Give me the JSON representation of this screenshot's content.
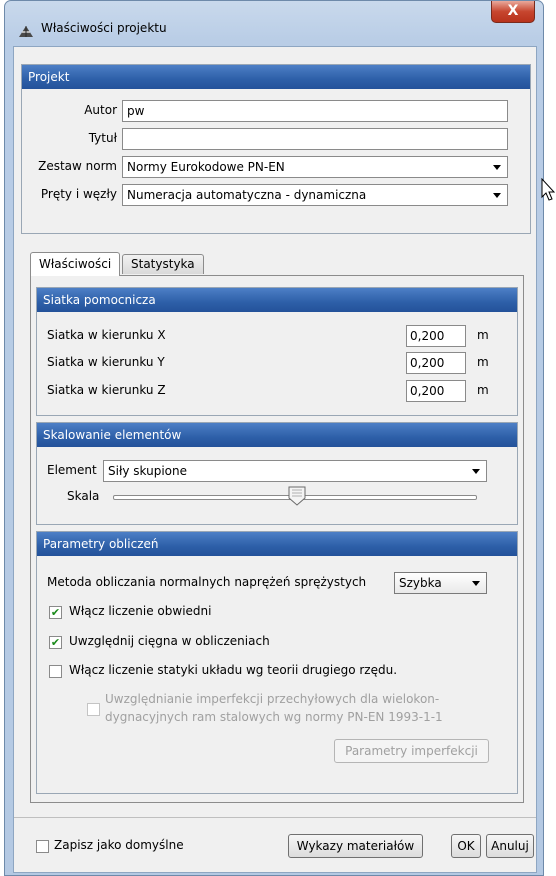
{
  "window": {
    "title": "Właściwości projektu",
    "close_label": "X"
  },
  "projekt": {
    "header": "Projekt",
    "autor_label": "Autor",
    "autor_value": "pw",
    "tytul_label": "Tytuł",
    "tytul_value": "",
    "zestaw_label": "Zestaw norm",
    "zestaw_value": "Normy Eurokodowe PN-EN",
    "prety_label": "Pręty i węzły",
    "prety_value": "Numeracja automatyczna - dynamiczna"
  },
  "tabs": {
    "wlasciwosci": "Właściwości",
    "statystyka": "Statystyka"
  },
  "siatka": {
    "header": "Siatka pomocnicza",
    "rows": [
      {
        "label": "Siatka w kierunku X",
        "value": "0,200",
        "unit": "m"
      },
      {
        "label": "Siatka w kierunku Y",
        "value": "0,200",
        "unit": "m"
      },
      {
        "label": "Siatka w kierunku Z",
        "value": "0,200",
        "unit": "m"
      }
    ]
  },
  "skalowanie": {
    "header": "Skalowanie elementów",
    "element_label": "Element",
    "element_value": "Siły skupione",
    "skala_label": "Skala",
    "skala_level": 0.5
  },
  "parametry": {
    "header": "Parametry obliczeń",
    "metoda_label": "Metoda obliczania normalnych naprężeń sprężystych",
    "metoda_value": "Szybka",
    "obwiednie_label": "Włącz liczenie obwiedni",
    "obwiednie_checked": true,
    "ciegna_label": "Uwzględnij cięgna w obliczeniach",
    "ciegna_checked": true,
    "statyka_label": "Włącz liczenie statyki układu wg teorii drugiego rzędu.",
    "statyka_checked": false,
    "imperfekcje_line1": "Uwzględnianie imperfekcji przechyłowych dla wielokon-",
    "imperfekcje_line2": "dygnacyjnych ram stalowych wg normy PN-EN 1993-1-1",
    "imperfekcje_checked": false,
    "imperfekcje_button": "Parametry imperfekcji"
  },
  "footer": {
    "zapisz_label": "Zapisz jako domyślne",
    "wykazy_button": "Wykazy materiałów",
    "ok_button": "OK",
    "anuluj_button": "Anuluj"
  },
  "colors": {
    "header_blue": "#2d5fa8",
    "check_green": "#1a8a1a"
  },
  "icons": {
    "title": "app-icon",
    "close": "close-icon",
    "dropdown": "chevron-down-icon",
    "check": "checkmark-icon",
    "cursor": "mouse-pointer-icon"
  }
}
